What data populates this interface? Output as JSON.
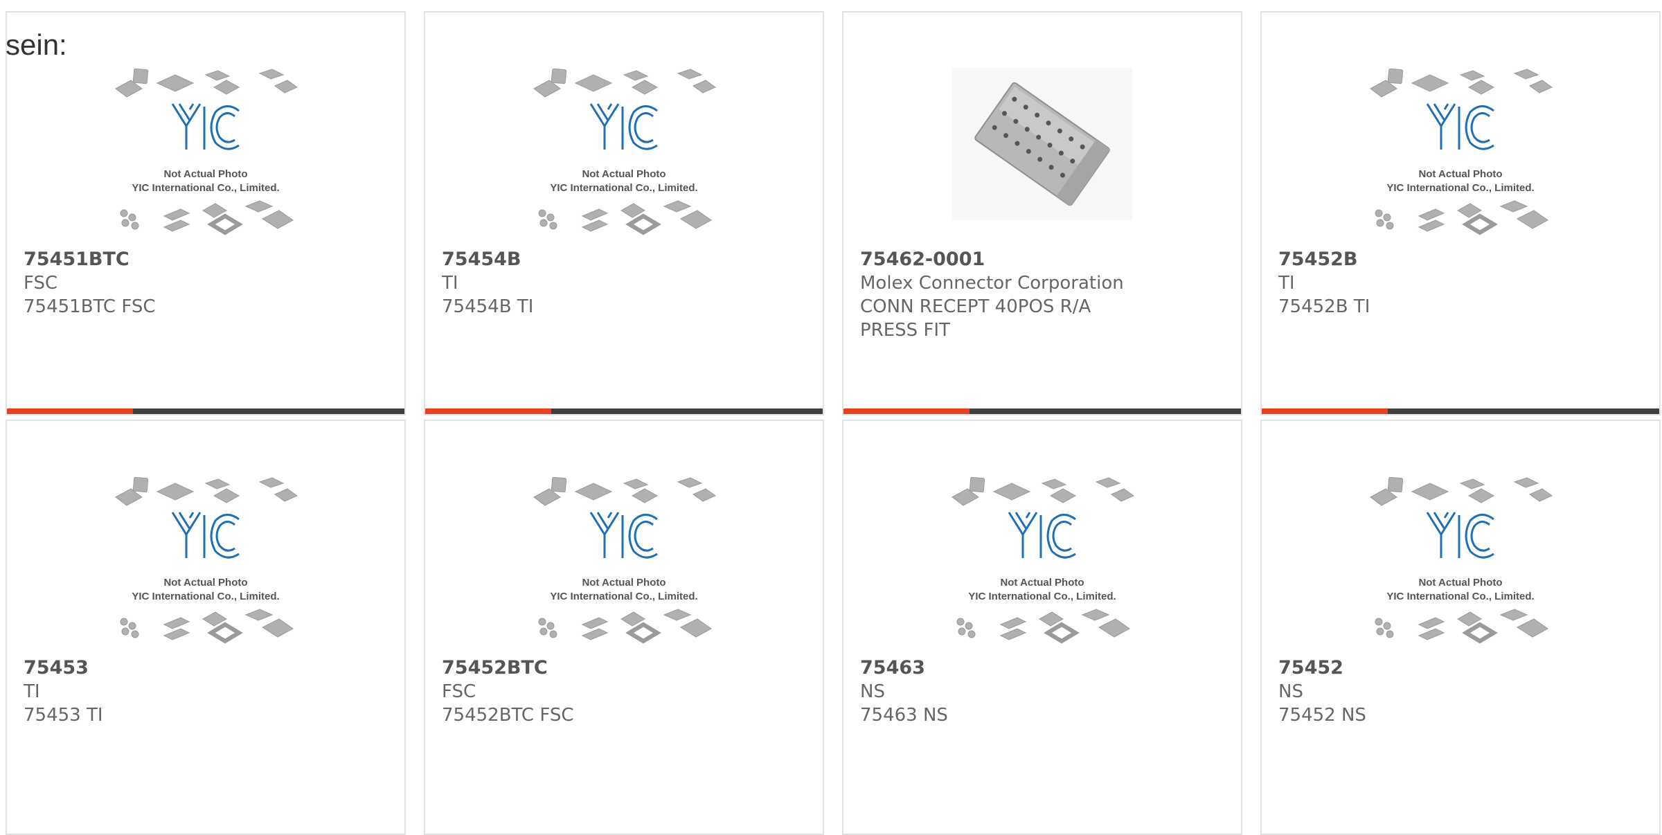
{
  "fragment_text": "sein:",
  "placeholder_text": {
    "line1": "Not Actual Photo",
    "line2": "YIC International Co., Limited."
  },
  "colors": {
    "accent": "#e8401c",
    "bar": "#3f3f3f",
    "logo_blue": "#1f6fb5"
  },
  "products": [
    {
      "part": "75451BTC",
      "maker": "FSC",
      "desc": "75451BTC FSC",
      "image": "placeholder-logo"
    },
    {
      "part": "75454B",
      "maker": "TI",
      "desc": "75454B TI",
      "image": "placeholder-logo"
    },
    {
      "part": "75462-0001",
      "maker": "Molex Connector Corporation",
      "desc": "CONN RECEPT 40POS R/A PRESS FIT",
      "image": "connector-photo"
    },
    {
      "part": "75452B",
      "maker": "TI",
      "desc": "75452B TI",
      "image": "placeholder-logo"
    },
    {
      "part": "75453",
      "maker": "TI",
      "desc": "75453 TI",
      "image": "placeholder-logo"
    },
    {
      "part": "75452BTC",
      "maker": "FSC",
      "desc": "75452BTC FSC",
      "image": "placeholder-logo"
    },
    {
      "part": "75463",
      "maker": "NS",
      "desc": "75463 NS",
      "image": "placeholder-logo"
    },
    {
      "part": "75452",
      "maker": "NS",
      "desc": "75452 NS",
      "image": "placeholder-logo"
    }
  ]
}
